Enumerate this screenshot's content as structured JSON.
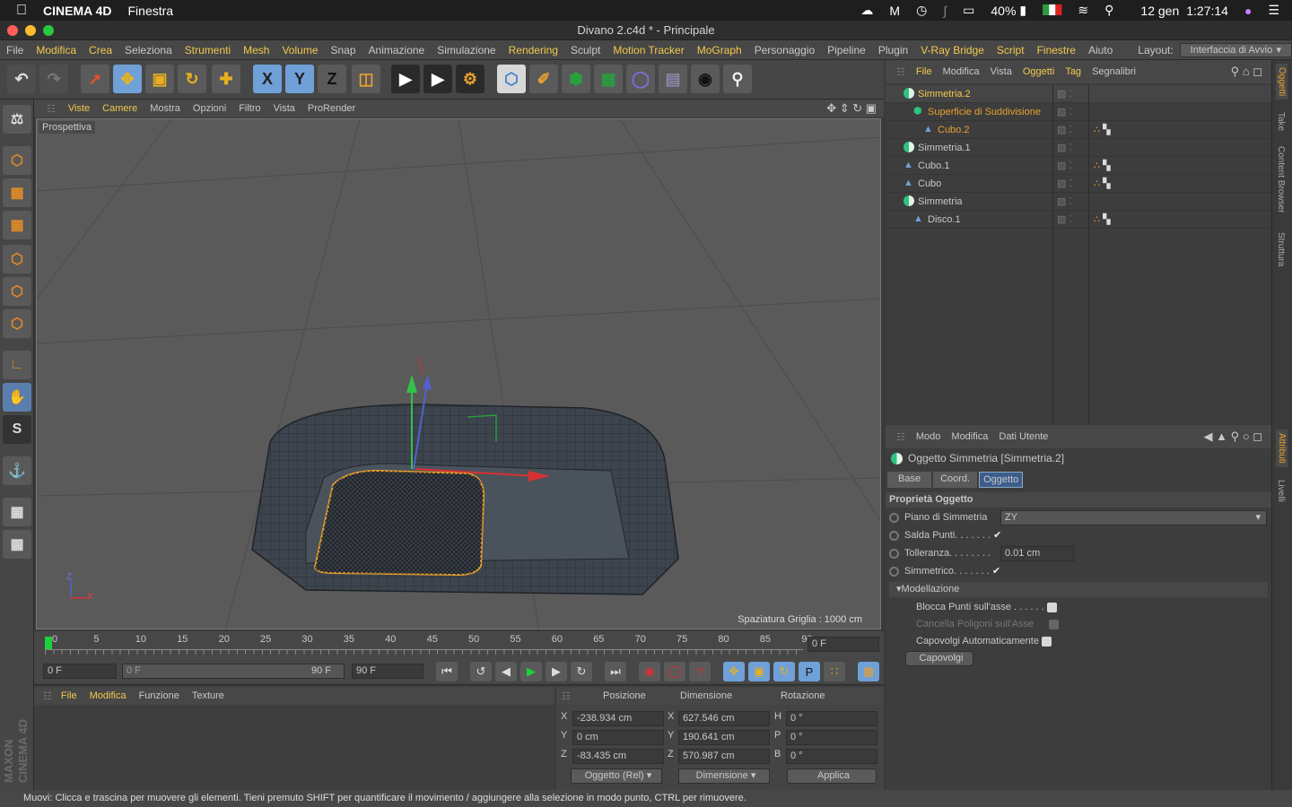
{
  "macbar": {
    "app": "CINEMA 4D",
    "menu": "Finestra",
    "battery": "40%",
    "date": "12 gen",
    "time": "1:27:14"
  },
  "window": {
    "title": "Divano 2.c4d * - Principale"
  },
  "menu": [
    "File",
    "Modifica",
    "Crea",
    "Seleziona",
    "Strumenti",
    "Mesh",
    "Volume",
    "Snap",
    "Animazione",
    "Simulazione",
    "Rendering",
    "Sculpt",
    "Motion Tracker",
    "MoGraph",
    "Personaggio",
    "Pipeline",
    "Plugin",
    "V-Ray Bridge",
    "Script",
    "Finestre",
    "Aiuto"
  ],
  "layout": {
    "label": "Layout:",
    "value": "Interfaccia di Avvio"
  },
  "toolbar": {
    "x": "X",
    "y": "Y",
    "z": "Z"
  },
  "viewport": {
    "menu": [
      "Viste",
      "Camere",
      "Mostra",
      "Opzioni",
      "Filtro",
      "Vista",
      "ProRender"
    ],
    "label": "Prospettiva",
    "grid_spacing": "Spaziatura Griglia : 1000 cm",
    "axis_z": "Z",
    "axis_x": "X"
  },
  "timeline": {
    "ticks": [
      "0",
      "5",
      "10",
      "15",
      "20",
      "25",
      "30",
      "35",
      "40",
      "45",
      "50",
      "55",
      "60",
      "65",
      "70",
      "75",
      "80",
      "85",
      "90"
    ],
    "current": "0 F",
    "start": "0 F",
    "range_start": "0 F",
    "range_end": "90 F",
    "end": "90 F"
  },
  "material": {
    "menu": [
      "File",
      "Modifica",
      "Funzione",
      "Texture"
    ]
  },
  "coords": {
    "headers": [
      "Posizione",
      "Dimensione",
      "Rotazione"
    ],
    "rows": [
      {
        "axis": "X",
        "pos": "-238.934 cm",
        "daxis": "X",
        "dim": "627.546 cm",
        "raxis": "H",
        "rot": "0 °"
      },
      {
        "axis": "Y",
        "pos": "0 cm",
        "daxis": "Y",
        "dim": "190.641 cm",
        "raxis": "P",
        "rot": "0 °"
      },
      {
        "axis": "Z",
        "pos": "-83.435 cm",
        "daxis": "Z",
        "dim": "570.987 cm",
        "raxis": "B",
        "rot": "0 °"
      }
    ],
    "mode": "Oggetto (Rel)",
    "dim_mode": "Dimensione",
    "apply": "Applica"
  },
  "objects": {
    "menu": [
      "File",
      "Modifica",
      "Vista",
      "Oggetti",
      "Tag",
      "Segnalibri"
    ],
    "items": [
      {
        "name": "Simmetria.2",
        "color": "#f2c94c"
      },
      {
        "name": "Superficie di Suddivisione",
        "color": "#e8a030"
      },
      {
        "name": "Cubo.2",
        "color": "#e8a030"
      },
      {
        "name": "Simmetria.1",
        "color": "#c8c8c8"
      },
      {
        "name": "Cubo.1",
        "color": "#c8c8c8"
      },
      {
        "name": "Cubo",
        "color": "#c8c8c8"
      },
      {
        "name": "Simmetria",
        "color": "#c8c8c8"
      },
      {
        "name": "Disco.1",
        "color": "#c8c8c8"
      }
    ]
  },
  "attributes": {
    "menu": [
      "Modo",
      "Modifica",
      "Dati Utente"
    ],
    "title": "Oggetto Simmetria [Simmetria.2]",
    "tabs": [
      "Base",
      "Coord.",
      "Oggetto"
    ],
    "section": "Proprietà Oggetto",
    "plane_label": "Piano di Simmetria",
    "plane_value": "ZY",
    "weld_label": "Salda Punti. . . . . . .",
    "tolerance_label": "Tolleranza. . . . . . . .",
    "tolerance_value": "0.01 cm",
    "symmetric_label": "Simmetrico. . . . . . .",
    "modeling": "Modellazione",
    "lock_label": "Blocca Punti sull'asse . . . . . .",
    "delete_label": "Cancella Poligoni sull'Asse",
    "flip_auto_label": "Capovolgi Automaticamente",
    "flip_button": "Capovolgi"
  },
  "right_tabs": [
    "Oggetti",
    "Take",
    "Content Browser",
    "Struttura",
    "Attributi",
    "Livelli"
  ],
  "status": "Muovi: Clicca e trascina per muovere gli elementi. Tieni premuto SHIFT per quantificare il movimento / aggiungere alla selezione in modo punto, CTRL per rimuovere.",
  "brand": "MAXON CINEMA 4D"
}
